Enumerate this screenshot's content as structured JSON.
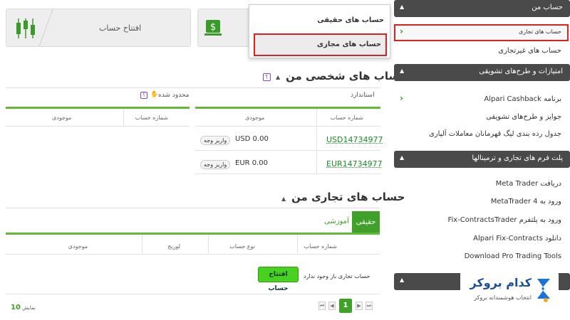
{
  "top_cards": {
    "open_account": "افتتاح حساب",
    "accounts_menu": {
      "real": "حساب های حقیقی",
      "demo": "حساب های مجازی"
    }
  },
  "personal": {
    "title": "حساب های شخصی من",
    "help": "؟",
    "standard_label": "استاندارد",
    "limited_label": "محدود شده",
    "columns_right": [
      "شماره حساب",
      "موجودی"
    ],
    "columns_left": [
      "شماره حساب",
      "موجودی"
    ],
    "rows": [
      {
        "account": "USD14734977",
        "balance": "USD 0.00",
        "action": "واریز وجه"
      },
      {
        "account": "EUR14734977",
        "balance": "EUR 0.00",
        "action": "واریز وجه"
      }
    ]
  },
  "trading": {
    "title": "حساب های تجاری من",
    "tabs": [
      "حقیقی",
      "آموزشی"
    ],
    "columns": [
      "شماره حساب",
      "نوع حساب",
      "لوریج",
      "موجودی"
    ],
    "empty_text": "حساب تجاری باز وجود ندارد",
    "open_button": "افتتاح حساب",
    "page_current": "1",
    "show_label": "نمایش",
    "show_count": "10"
  },
  "sidebar": {
    "sections": [
      {
        "title": "حساب من",
        "items": [
          "حساب های تجاری",
          "حساب های غیرتجاری"
        ]
      },
      {
        "title": "امتیازات و طرح‌های تشویقی",
        "items": [
          "برنامه Alpari Cashback",
          "جوایز و طرح‌های تشویقی",
          "جدول رده بندی لیگ قهرمانان معاملات آلپاری"
        ]
      },
      {
        "title": "پلت فرم های تجاری و ترمینالها",
        "items": [
          "دریافت Meta Trader",
          "ورود به MetaTrader 4",
          "ورود به پلتفرم Fix-ContractsTrader",
          "دانلود Alpari Fix-Contracts",
          "Download Pro Trading Tools"
        ]
      }
    ]
  },
  "watermark": {
    "brand": "کدام بروکر",
    "tagline": "انتخاب هوشمندانه بروکر"
  },
  "colors": {
    "accent": "#3fa02a",
    "sidebar_header": "#4a4a4a",
    "highlight": "#e02020"
  }
}
